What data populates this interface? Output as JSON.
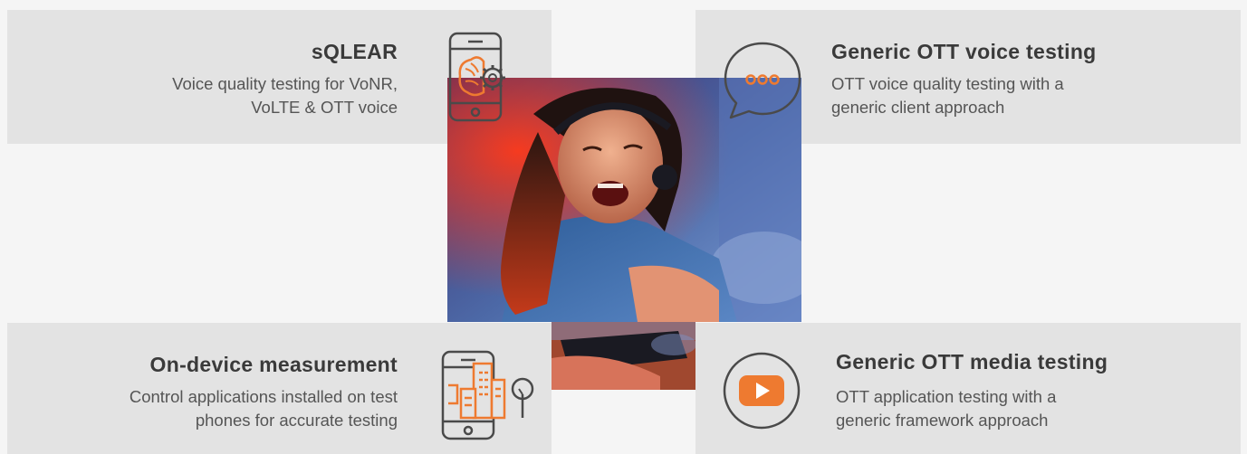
{
  "colors": {
    "accent": "#ee7a30",
    "icon_stroke": "#4a4a4a",
    "card_bg": "#e3e3e3",
    "page_bg": "#f5f5f5"
  },
  "cards": {
    "sqlear": {
      "title": "sQLEAR",
      "desc_line1": "Voice quality testing for VoNR,",
      "desc_line2": "VoLTE & OTT voice",
      "icon": "phone-brain-gear-icon"
    },
    "ott_voice": {
      "title": "Generic OTT voice testing",
      "desc_line1": "OTT voice quality testing with a",
      "desc_line2": "generic client approach",
      "icon": "chat-bubble-icon"
    },
    "on_device": {
      "title": "On-device measurement",
      "desc_line1": "Control applications installed on test",
      "desc_line2": "phones for accurate testing",
      "icon": "phone-city-icon"
    },
    "ott_media": {
      "title": "Generic OTT media testing",
      "desc_line1": "OTT application testing with a",
      "desc_line2": "generic framework approach",
      "icon": "play-button-icon"
    }
  },
  "photo": {
    "subject": "woman-gaming-photo"
  }
}
